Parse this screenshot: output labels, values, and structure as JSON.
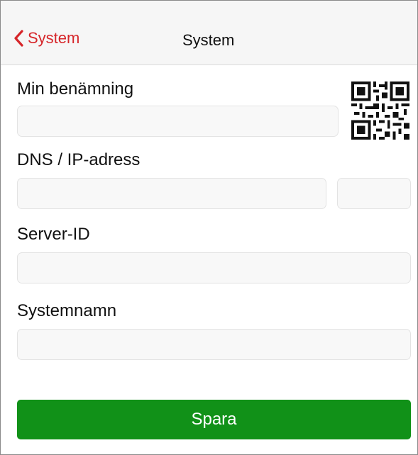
{
  "navbar": {
    "back_label": "System",
    "title": "System"
  },
  "form": {
    "name_label": "Min benämning",
    "name_value": "",
    "dns_label": "DNS / IP-adress",
    "dns_value": "",
    "port_value": "",
    "server_id_label": "Server-ID",
    "server_id_value": "",
    "system_name_label": "Systemnamn",
    "system_name_value": ""
  },
  "qr": {
    "icon": "qr-code-icon"
  },
  "actions": {
    "save_label": "Spara"
  },
  "colors": {
    "accent": "#d6262a",
    "save_button": "#119118",
    "field_bg": "#f8f8f8",
    "navbar_bg": "#f6f6f6"
  }
}
